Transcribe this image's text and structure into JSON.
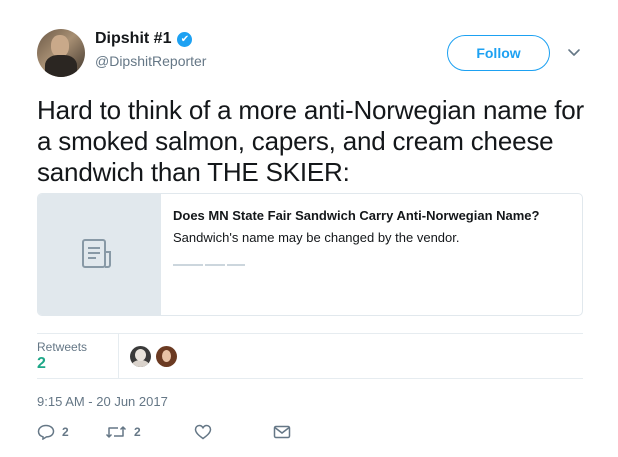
{
  "user": {
    "display_name": "Dipshit #1",
    "handle": "@DipshitReporter",
    "verified_mark": "✔"
  },
  "follow_label": "Follow",
  "tweet_text": "Hard to think of a more anti-Norwegian name for a smoked salmon, capers, and cream cheese sandwich than THE SKIER:",
  "card": {
    "title": "Does MN State Fair Sandwich Carry Anti-Norwegian Name?",
    "description": "Sandwich's name may be changed by the vendor."
  },
  "stats": {
    "retweets_label": "Retweets",
    "retweets_count": "2"
  },
  "timestamp": "9:15 AM - 20 Jun 2017",
  "actions": {
    "reply_count": "2",
    "retweet_count": "2"
  },
  "colors": {
    "accent": "#1da1f2",
    "muted": "#657786",
    "retweet_count": "#1ea788"
  },
  "icons": [
    "verified-icon",
    "chevron-down-icon",
    "document-icon",
    "reply-icon",
    "retweet-icon",
    "like-icon",
    "message-icon"
  ]
}
